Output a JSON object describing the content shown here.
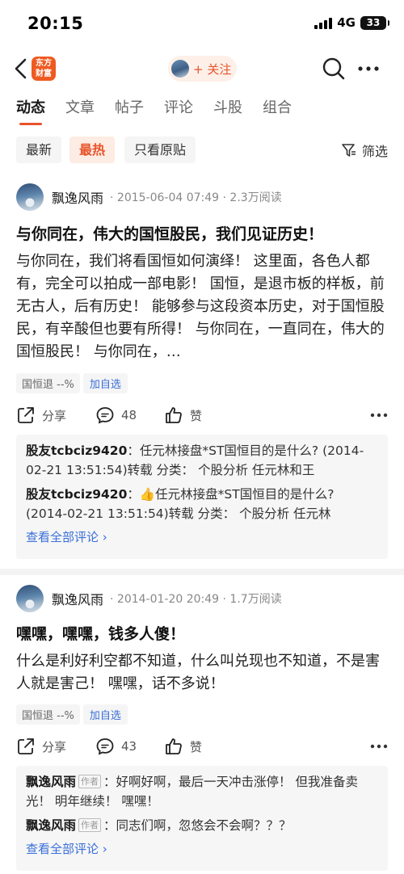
{
  "status_bar": {
    "time": "20:15",
    "network": "4G",
    "battery": "33"
  },
  "navbar": {
    "logo_line1": "东方",
    "logo_line2": "财富",
    "follow_label": "+ 关注"
  },
  "tabs": [
    "动态",
    "文章",
    "帖子",
    "评论",
    "斗股",
    "组合"
  ],
  "filters": {
    "chips": [
      "最新",
      "最热",
      "只看原贴"
    ],
    "filter_label": "筛选"
  },
  "posts": [
    {
      "author": "飘逸风雨",
      "meta": "· 2015-06-04 07:49 · 2.3万阅读",
      "title": "与你同在，伟大的国恒股民，我们见证历史！",
      "body": "与你同在，我们将看国恒如何演绎！ 这里面，各色人都有，完全可以拍成一部电影！ 国恒，是退市板的样板，前无古人，后有历史！ 能够参与这段资本历史，对于国恒股民，有辛酸但也要有所得！ 与你同在，一直同在，伟大的国恒股民！ 与你同在，…",
      "stock_tag": "国恒退 --%",
      "add_label": "加自选",
      "share_label": "分享",
      "comment_count": "48",
      "like_label": "赞",
      "comments": [
        {
          "author": "股友tcbciz9420",
          "sep": "：",
          "text": "任元林接盘*ST国恒目的是什么? (2014-02-21 13:51:54)转载   分类：  个股分析      任元林和王"
        },
        {
          "author": "股友tcbciz9420",
          "sep": "：",
          "text": "👍任元林接盘*ST国恒目的是什么? (2014-02-21 13:51:54)转载   分类：  个股分析      任元林"
        }
      ],
      "see_all": "查看全部评论 ›"
    },
    {
      "author": "飘逸风雨",
      "meta": "· 2014-01-20 20:49 · 1.7万阅读",
      "title": "嘿嘿，嘿嘿，钱多人傻！",
      "body": "什么是利好利空都不知道，什么叫兑现也不知道，不是害人就是害己！ 嘿嘿，话不多说！",
      "stock_tag": "国恒退 --%",
      "add_label": "加自选",
      "share_label": "分享",
      "comment_count": "43",
      "like_label": "赞",
      "comments": [
        {
          "author": "飘逸风雨",
          "badge": "作者",
          "sep": "：",
          "text": "好啊好啊，最后一天冲击涨停！  但我准备卖光！  明年继续！  嘿嘿！"
        },
        {
          "author": "飘逸风雨",
          "badge": "作者",
          "sep": "：",
          "text": "同志们啊，忽悠会不会啊？？？"
        }
      ],
      "see_all": "查看全部评论 ›"
    }
  ]
}
